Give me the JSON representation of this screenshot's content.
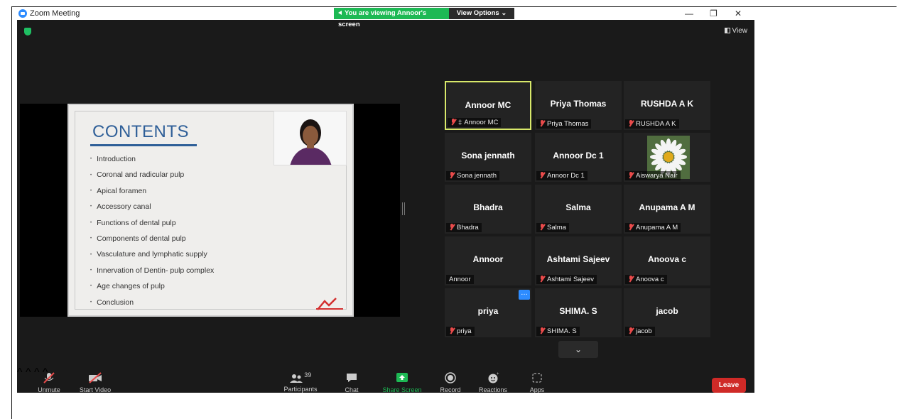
{
  "window": {
    "title": "Zoom Meeting"
  },
  "banner": {
    "viewing": "You are viewing Annoor's screen",
    "view_options": "View Options ⌄"
  },
  "controls": {
    "minimize": "—",
    "maximize": "❐",
    "close": "✕",
    "view": "View"
  },
  "slide": {
    "title": "CONTENTS",
    "items": [
      "Introduction",
      "Coronal and radicular pulp",
      "Apical foramen",
      "Accessory canal",
      "Functions of dental pulp",
      "Components of dental pulp",
      "Vasculature and lymphatic supply",
      "Innervation of Dentin- pulp complex",
      "Age changes of pulp",
      "Conclusion"
    ]
  },
  "participants": [
    {
      "display": "Annoor MC",
      "label": "Annoor MC",
      "muted": true,
      "pinned": true,
      "active": true
    },
    {
      "display": "Priya Thomas",
      "label": "Priya Thomas",
      "muted": true
    },
    {
      "display": "RUSHDA A K",
      "label": "RUSHDA A K",
      "muted": true
    },
    {
      "display": "Sona jennath",
      "label": "Sona jennath",
      "muted": true
    },
    {
      "display": "Annoor Dc 1",
      "label": "Annoor Dc 1",
      "muted": true
    },
    {
      "display": "",
      "label": "Aiswarya Nair",
      "muted": true,
      "photo": true
    },
    {
      "display": "Bhadra",
      "label": "Bhadra",
      "muted": true
    },
    {
      "display": "Salma",
      "label": "Salma",
      "muted": true
    },
    {
      "display": "Anupama A M",
      "label": "Anupama A M",
      "muted": true
    },
    {
      "display": "Annoor",
      "label": "Annoor",
      "muted": false
    },
    {
      "display": "Ashtami Sajeev",
      "label": "Ashtami Sajeev",
      "muted": true
    },
    {
      "display": "Anoova c",
      "label": "Anoova c",
      "muted": true
    },
    {
      "display": "priya",
      "label": "priya",
      "muted": true,
      "more": "…"
    },
    {
      "display": "SHIMA. S",
      "label": "SHIMA. S",
      "muted": true
    },
    {
      "display": "jacob",
      "label": "jacob",
      "muted": true
    }
  ],
  "toolbar": {
    "unmute": "Unmute",
    "start_video": "Start Video",
    "participants": "Participants",
    "participants_count": "39",
    "chat": "Chat",
    "share_screen": "Share Screen",
    "record": "Record",
    "reactions": "Reactions",
    "apps": "Apps",
    "leave": "Leave"
  },
  "colors": {
    "accent": "#2d8cff",
    "share_green": "#1db954",
    "leave_red": "#cf2a27",
    "active_border": "#d8e86a"
  }
}
